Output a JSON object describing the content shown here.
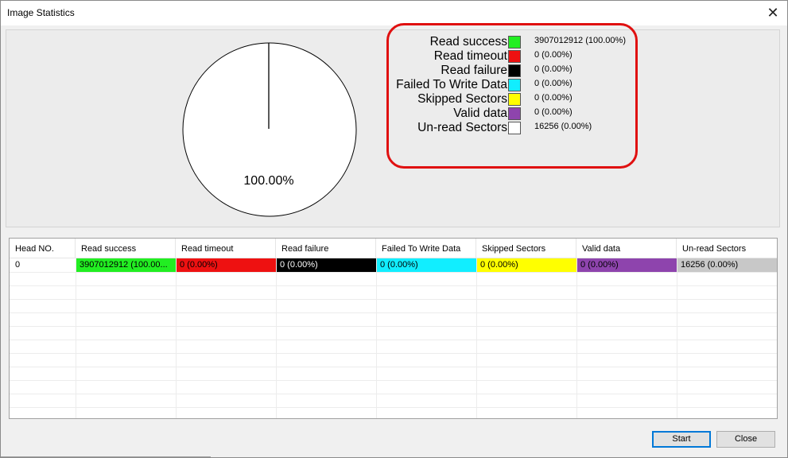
{
  "window": {
    "title": "Image Statistics",
    "close_glyph": "✕"
  },
  "pie": {
    "label": "100.00%",
    "slices": [
      {
        "name": "Read success",
        "fraction": 1.0,
        "color": "#ffffff"
      }
    ]
  },
  "legend": {
    "items": [
      {
        "name": "Read success",
        "color": "#22ee22",
        "value": "3907012912 (100.00%)"
      },
      {
        "name": "Read timeout",
        "color": "#ee1111",
        "value": "0 (0.00%)"
      },
      {
        "name": "Read failure",
        "color": "#000000",
        "value": "0 (0.00%)"
      },
      {
        "name": "Failed To Write Data",
        "color": "#11eeff",
        "value": "0 (0.00%)"
      },
      {
        "name": "Skipped Sectors",
        "color": "#ffff00",
        "value": "0 (0.00%)"
      },
      {
        "name": "Valid data",
        "color": "#8e44ad",
        "value": "0 (0.00%)"
      },
      {
        "name": "Un-read Sectors",
        "color": "#ffffff",
        "value": "16256 (0.00%)"
      }
    ]
  },
  "table": {
    "columns": [
      "Head NO.",
      "Read success",
      "Read timeout",
      "Read failure",
      "Failed To Write Data",
      "Skipped Sectors",
      "Valid data",
      "Un-read Sectors"
    ],
    "rows": [
      [
        "0",
        "3907012912 (100.00...",
        "0 (0.00%)",
        "0 (0.00%)",
        "0 (0.00%)",
        "0 (0.00%)",
        "0 (0.00%)",
        "16256 (0.00%)"
      ]
    ],
    "cell_colors": [
      "#ffffff",
      "#22ee22",
      "#ee1111",
      "#000000",
      "#11eeff",
      "#ffff00",
      "#8e44ad",
      "#c8c8c8"
    ],
    "cell_text_colors": [
      "#000000",
      "#000000",
      "#000000",
      "#ffffff",
      "#000000",
      "#000000",
      "#000000",
      "#000000"
    ]
  },
  "buttons": {
    "start": "Start",
    "close": "Close"
  }
}
